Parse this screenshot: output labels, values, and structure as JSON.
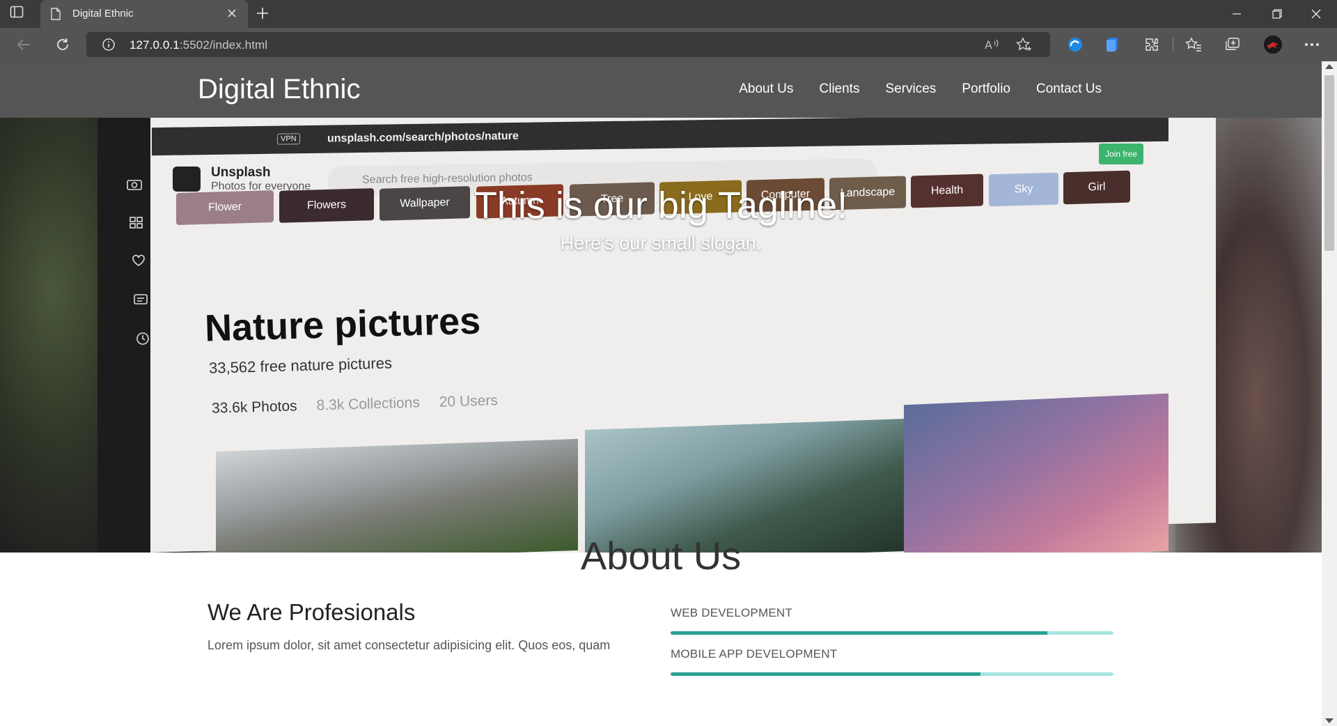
{
  "browser": {
    "tab_title": "Digital Ethnic",
    "url_host": "127.0.0.1",
    "url_rest": ":5502/index.html"
  },
  "site": {
    "brand": "Digital Ethnic",
    "nav": [
      "About Us",
      "Clients",
      "Services",
      "Portfolio",
      "Contact Us"
    ]
  },
  "hero": {
    "tagline": "This is our big Tagline!",
    "slogan": "Here's our small slogan.",
    "photo": {
      "url": "unsplash.com/search/photos/nature",
      "vpn": "VPN",
      "site_name": "Unsplash",
      "site_sub": "Photos for everyone",
      "search_placeholder": "Search free high-resolution photos",
      "join": "Join free",
      "chips": [
        "Flower",
        "Flowers",
        "Wallpaper",
        "Autumn",
        "Tree",
        "Love",
        "Computer",
        "Landscape",
        "Health",
        "Sky",
        "Girl"
      ],
      "heading": "Nature pictures",
      "count": "33,562 free nature pictures",
      "stats": [
        "33.6k Photos",
        "8.3k Collections",
        "20 Users"
      ]
    }
  },
  "about": {
    "title": "About Us",
    "subtitle": "We Are Profesionals",
    "text": "Lorem ipsum dolor, sit amet consectetur adipisicing elit. Quos eos, quam",
    "skills": [
      {
        "label": "WEB DEVELOPMENT",
        "level": 0.85
      },
      {
        "label": "MOBILE APP DEVELOPMENT",
        "level": 0.7
      }
    ]
  },
  "colors": {
    "navbar": "#555555",
    "skill_fill": "#2aa092",
    "skill_track": "#a8e6e0"
  }
}
